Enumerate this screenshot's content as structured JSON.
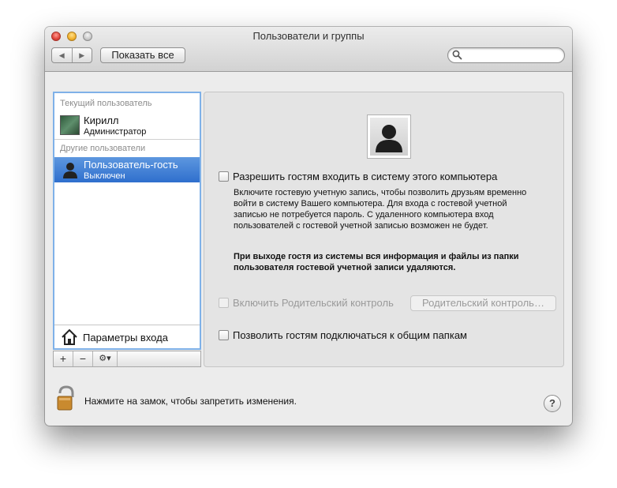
{
  "window": {
    "title": "Пользователи и группы"
  },
  "toolbar": {
    "back_label": "◀",
    "forward_label": "▶",
    "show_all": "Показать все",
    "search_placeholder": ""
  },
  "sidebar": {
    "current_header": "Текущий пользователь",
    "current_user": {
      "name": "Кирилл",
      "role": "Администратор"
    },
    "other_header": "Другие пользователи",
    "guest_user": {
      "name": "Пользователь-гость",
      "status": "Выключен"
    },
    "login_options": "Параметры входа"
  },
  "sidebar_tools": {
    "add": "+",
    "remove": "−",
    "action": "⚙▾"
  },
  "guest_panel": {
    "allow_login": {
      "label": "Разрешить гостям входить в систему этого компьютера",
      "checked": false
    },
    "description": "Включите гостевую учетную запись, чтобы позволить друзьям временно войти в систему Вашего компьютера. Для входа с гостевой учетной записью не потребуется пароль. С удаленного компьютера вход пользователей с гостевой учетной записью возможен не будет.",
    "warning": "При выходе гостя из системы вся информация и файлы из папки пользователя гостевой учетной записи удаляются.",
    "parental": {
      "label": "Включить Родительский контроль",
      "checked": false,
      "enabled": false
    },
    "parental_button": "Родительский контроль…",
    "shared_folders": {
      "label": "Позволить гостям подключаться к общим папкам",
      "checked": false
    }
  },
  "footer": {
    "lock_text": "Нажмите на замок, чтобы запретить изменения.",
    "help": "?"
  }
}
